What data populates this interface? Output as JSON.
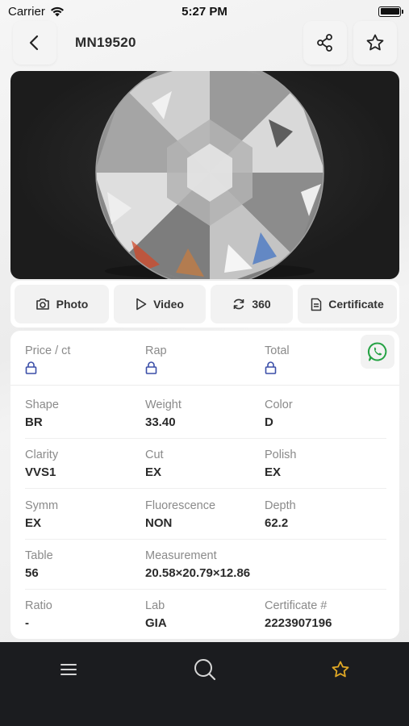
{
  "status_bar": {
    "carrier": "Carrier",
    "time": "5:27 PM"
  },
  "header": {
    "title": "MN19520"
  },
  "media_tabs": [
    {
      "label": "Photo",
      "icon": "camera-icon"
    },
    {
      "label": "Video",
      "icon": "play-icon"
    },
    {
      "label": "360",
      "icon": "rotate-icon"
    },
    {
      "label": "Certificate",
      "icon": "document-icon"
    }
  ],
  "pricing": {
    "price_per_ct_label": "Price / ct",
    "rap_label": "Rap",
    "total_label": "Total"
  },
  "details": {
    "shape_label": "Shape",
    "shape": "BR",
    "weight_label": "Weight",
    "weight": "33.40",
    "color_label": "Color",
    "color": "D",
    "clarity_label": "Clarity",
    "clarity": "VVS1",
    "cut_label": "Cut",
    "cut": "EX",
    "polish_label": "Polish",
    "polish": "EX",
    "symm_label": "Symm",
    "symm": "EX",
    "fluorescence_label": "Fluorescence",
    "fluorescence": "NON",
    "depth_label": "Depth",
    "depth": "62.2",
    "table_label": "Table",
    "table": "56",
    "measurement_label": "Measurement",
    "measurement": "20.58×20.79×12.86",
    "ratio_label": "Ratio",
    "ratio": "-",
    "lab_label": "Lab",
    "lab": "GIA",
    "certificate_no_label": "Certificate #",
    "certificate_no": "2223907196"
  },
  "colors": {
    "lock_icon": "#3b4fa8",
    "whatsapp": "#25a244",
    "tabbar_bg": "#1b1c1f",
    "active_star": "#e0a825"
  },
  "tabbar": [
    {
      "icon": "menu-icon",
      "active": false
    },
    {
      "icon": "search-icon",
      "active": false
    },
    {
      "icon": "star-icon",
      "active": true
    }
  ]
}
